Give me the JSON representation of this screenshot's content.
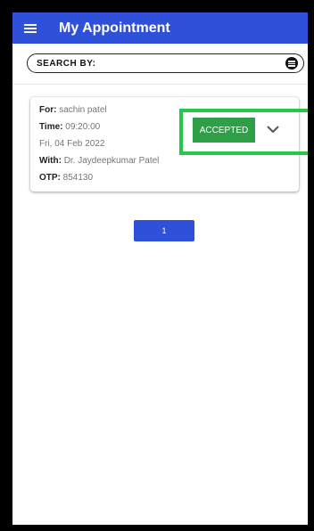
{
  "header": {
    "title": "My Appointment",
    "menu_icon": "menu-icon"
  },
  "search": {
    "label": "SEARCH BY:",
    "filter_icon": "filter-icon"
  },
  "appointment": {
    "for_label": "For:",
    "for_value": "sachin patel",
    "time_label": "Time:",
    "time_value": "09:20:00",
    "date": "Fri, 04 Feb 2022",
    "with_label": "With:",
    "with_value": "Dr. Jaydeepkumar Patel",
    "otp_label": "OTP:",
    "otp_value": "854130",
    "status": "ACCEPTED",
    "expand_icon": "chevron-down-icon"
  },
  "pagination": {
    "page": "1"
  },
  "colors": {
    "appbar": "#2f50d8",
    "status": "#2e9f46",
    "highlight": "#26c84a"
  }
}
